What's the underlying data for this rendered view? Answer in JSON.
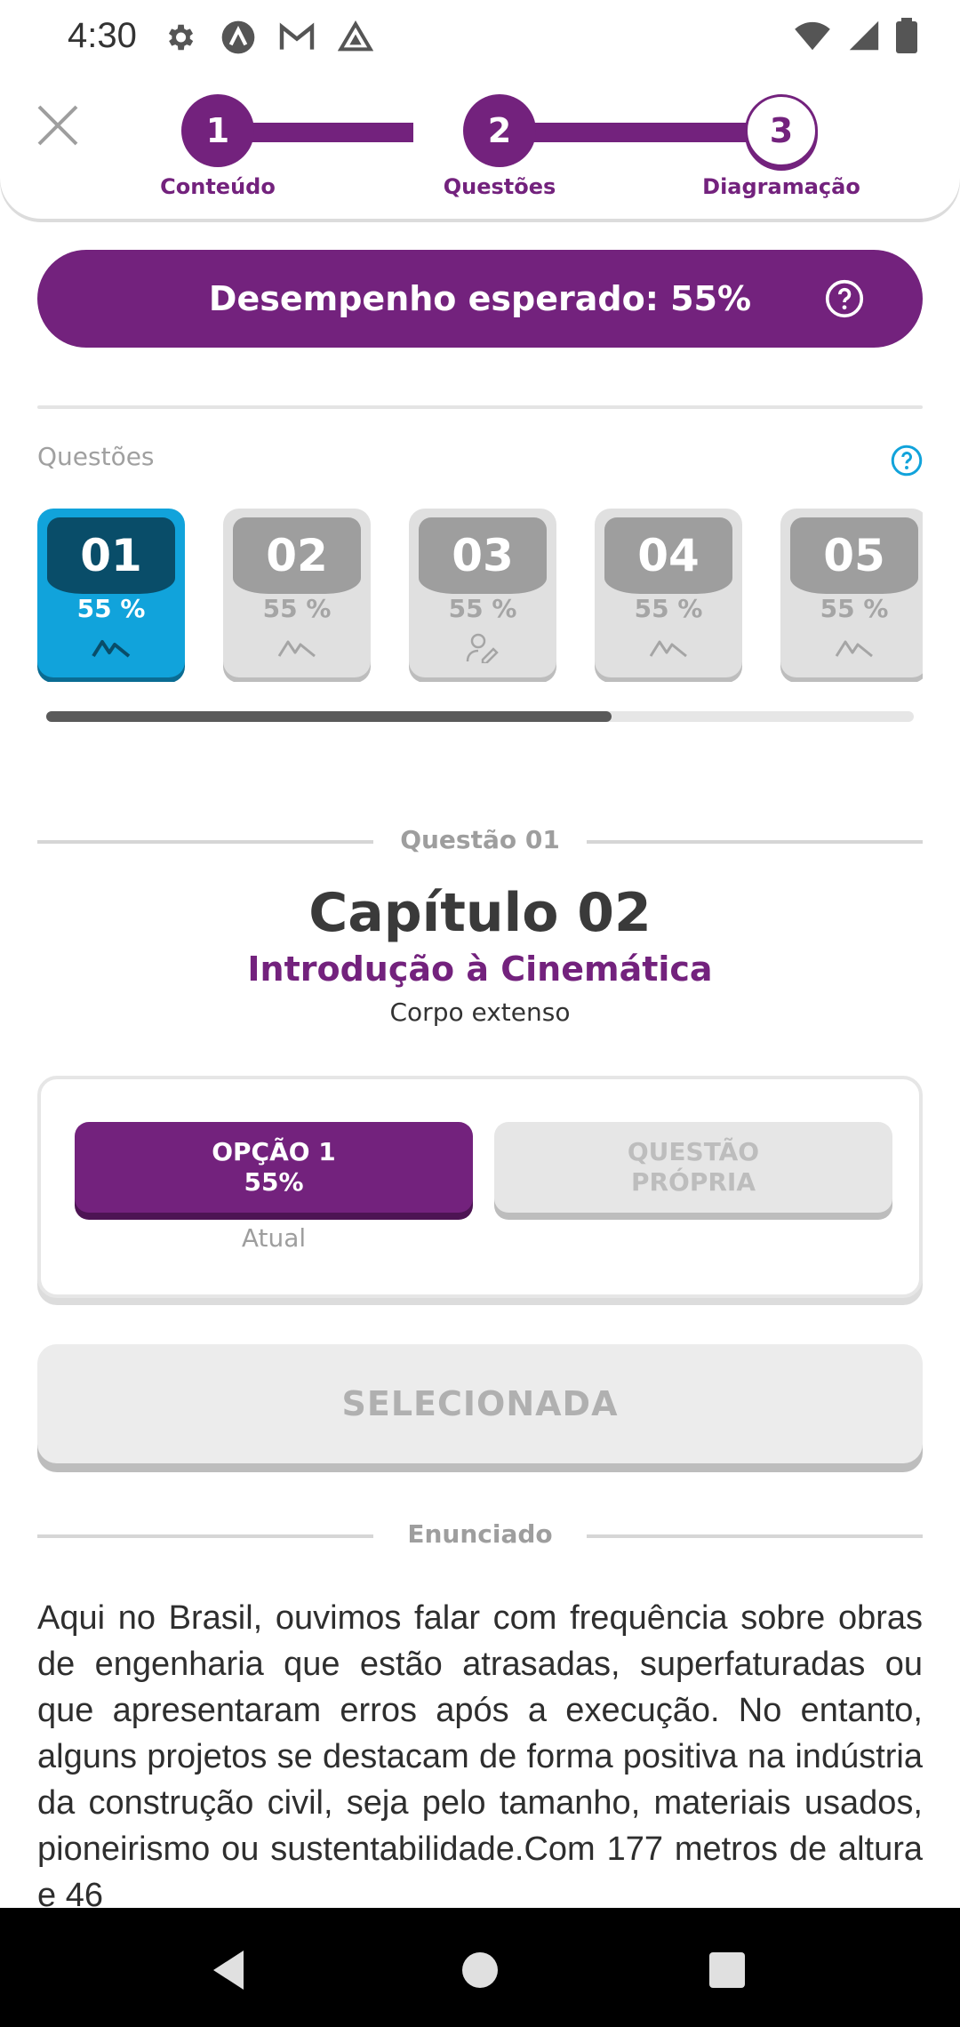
{
  "status_bar": {
    "time": "4:30"
  },
  "stepper": {
    "steps": [
      {
        "number": "1",
        "label": "Conteúdo"
      },
      {
        "number": "2",
        "label": "Questões"
      },
      {
        "number": "3",
        "label": "Diagramação"
      }
    ],
    "accent_color": "#73227d"
  },
  "performance": {
    "text": "Desempenho esperado: 55%"
  },
  "questions_section": {
    "label": "Questões",
    "cards": [
      {
        "number": "01",
        "percent": "55 %",
        "icon": "mountain-icon",
        "active": true
      },
      {
        "number": "02",
        "percent": "55 %",
        "icon": "mountain-icon",
        "active": false
      },
      {
        "number": "03",
        "percent": "55 %",
        "icon": "user-edit-icon",
        "active": false
      },
      {
        "number": "04",
        "percent": "55 %",
        "icon": "mountain-icon",
        "active": false
      },
      {
        "number": "05",
        "percent": "55 %",
        "icon": "mountain-icon",
        "active": false
      }
    ],
    "scroll_position": 0.65
  },
  "question": {
    "header": "Questão 01",
    "chapter": "Capítulo 02",
    "topic": "Introdução à Cinemática",
    "subtopic": "Corpo extenso"
  },
  "options": {
    "option1_line1": "OPÇÃO 1",
    "option1_line2": "55%",
    "option1_caption": "Atual",
    "option2_line1": "QUESTÃO",
    "option2_line2": "PRÓPRIA"
  },
  "selected_button": "SELECIONADA",
  "statement": {
    "header": "Enunciado",
    "text": "Aqui no Brasil, ouvimos falar com frequência sobre obras de engenharia que estão atrasadas, superfaturadas ou que apresentaram erros após a execução. No entanto, alguns projetos se destacam de forma positiva na indústria da construção civil, seja pelo tamanho, materiais usados, pioneirismo ou sustentabilidade.Com 177 metros de altura e 46"
  }
}
